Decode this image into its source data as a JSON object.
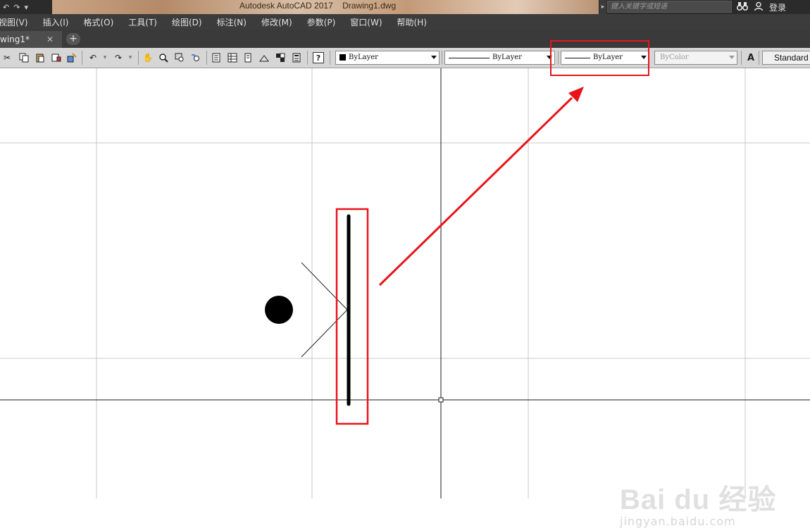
{
  "titlebar": {
    "app_title": "Autodesk AutoCAD 2017    Drawing1.dwg",
    "search_placeholder": "键入关键字或短语",
    "login_label": "登录",
    "qat_icons": [
      "undo-icon",
      "redo-icon",
      "dropdown-icon"
    ]
  },
  "menu": {
    "items": [
      {
        "label": "视图(V)"
      },
      {
        "label": "插入(I)"
      },
      {
        "label": "格式(O)"
      },
      {
        "label": "工具(T)"
      },
      {
        "label": "绘图(D)"
      },
      {
        "label": "标注(N)"
      },
      {
        "label": "修改(M)"
      },
      {
        "label": "参数(P)"
      },
      {
        "label": "窗口(W)"
      },
      {
        "label": "帮助(H)"
      }
    ]
  },
  "tabs": {
    "doc_tab_label": "wing1*",
    "close_glyph": "✕",
    "new_tab_glyph": "+"
  },
  "toolbar": {
    "color_combo": "ByLayer",
    "linetype_combo": "ByLayer",
    "lineweight_combo": "ByLayer",
    "plotstyle_combo": "ByColor",
    "text_style": "Standard",
    "help_glyph": "?"
  },
  "watermark": {
    "logo": "Bai du 经验",
    "url": "jingyan.baidu.com"
  },
  "colors": {
    "highlight_red": "#e8141a",
    "canvas_bg": "#ffffff",
    "menu_bg": "#3c3c3c",
    "toolbar_bg": "#d6d6d6"
  }
}
